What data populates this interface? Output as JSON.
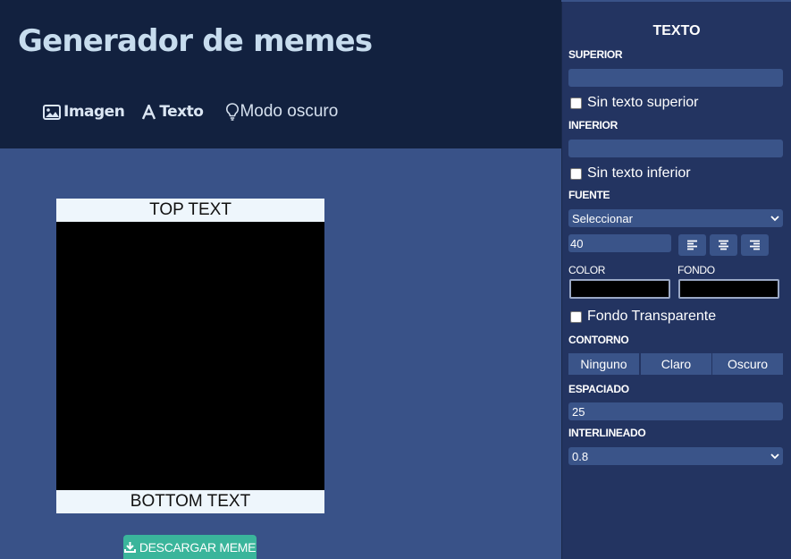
{
  "header": {
    "title": "Generador de memes",
    "nav": [
      {
        "label": "Imagen",
        "icon": "image-icon"
      },
      {
        "label": "Texto",
        "icon": "text-icon"
      },
      {
        "label": "Modo oscuro",
        "icon": "lightbulb-icon"
      }
    ]
  },
  "meme": {
    "top_text": "TOP TEXT",
    "bottom_text": "BOTTOM TEXT",
    "download_label": "DESCARGAR MEME"
  },
  "panel": {
    "title": "TEXTO",
    "top_label": "SUPERIOR",
    "top_value": "",
    "no_top_label": "Sin texto superior",
    "bottom_label": "INFERIOR",
    "bottom_value": "",
    "no_bottom_label": "Sin texto inferior",
    "font_label": "FUENTE",
    "font_value": "Seleccionar",
    "font_size": "40",
    "align_options": [
      "left",
      "center",
      "right"
    ],
    "color_label": "COLOR",
    "bg_label": "FONDO",
    "text_color": "#000000",
    "bg_color": "#000000",
    "transparent_label": "Fondo Transparente",
    "outline_label": "CONTORNO",
    "outline_options": [
      "Ninguno",
      "Claro",
      "Oscuro"
    ],
    "spacing_label": "ESPACIADO",
    "spacing_value": "25",
    "line_height_label": "INTERLINEADO",
    "line_height_value": "0.8"
  }
}
